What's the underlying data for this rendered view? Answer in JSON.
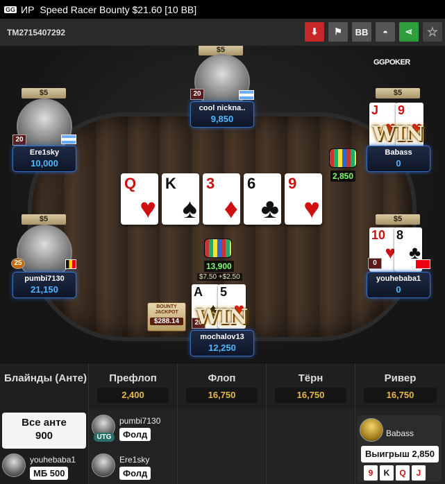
{
  "titlebar": {
    "logo": "GG",
    "game_type": "ИР",
    "title": "Speed Racer Bounty $21.60 [10 BB]"
  },
  "hud": {
    "tournament_id": "TM2715407292",
    "buttons": [
      {
        "name": "download-button",
        "label": "⬇"
      },
      {
        "name": "report-button",
        "label": "⚑"
      },
      {
        "name": "bb-toggle-button",
        "label": "BB"
      },
      {
        "name": "hide-button",
        "label": "◓"
      },
      {
        "name": "share-button",
        "label": "⋖"
      },
      {
        "name": "favorite-button",
        "label": "☆"
      }
    ]
  },
  "brand": {
    "gg": "GG",
    "poker": "POKER"
  },
  "board": [
    {
      "rank": "Q",
      "suit": "♥",
      "color": "red"
    },
    {
      "rank": "K",
      "suit": "♠",
      "color": "black"
    },
    {
      "rank": "3",
      "suit": "♦",
      "color": "red"
    },
    {
      "rank": "6",
      "suit": "♣",
      "color": "black"
    },
    {
      "rank": "9",
      "suit": "♥",
      "color": "red"
    }
  ],
  "seats": {
    "top": {
      "name": "cool nickna..",
      "stack": "9,850",
      "bet": "$5",
      "level": "20"
    },
    "left_upper": {
      "name": "Ere1sky",
      "stack": "10,000",
      "bet": "$5",
      "level": "20"
    },
    "right_upper": {
      "name": "Babass",
      "stack": "0",
      "bet": "$5",
      "win_label": "WIN",
      "cards": [
        {
          "rank": "J",
          "suit": "♥"
        },
        {
          "rank": "9",
          "suit": "♥"
        }
      ],
      "chip_count": "2,850"
    },
    "left_lower": {
      "name": "pumbi7130",
      "stack": "21,150",
      "bet": "$5",
      "level": "25"
    },
    "right_lower": {
      "name": "youhebaba1",
      "stack": "0",
      "bet": "$5",
      "level": "0",
      "cards": [
        {
          "rank": "10",
          "suit": "♥",
          "color": "red"
        },
        {
          "rank": "8",
          "suit": "♣",
          "color": "black"
        }
      ]
    },
    "hero": {
      "name": "mochalov13",
      "stack": "12,250",
      "win_label": "WIN",
      "level": "20",
      "cards": [
        {
          "rank": "A",
          "suit": "♠"
        },
        {
          "rank": "5",
          "suit": "♥"
        }
      ]
    }
  },
  "pot": {
    "total": "13,900",
    "side_bets": "$7.50 +$2.50"
  },
  "bounty_jackpot": {
    "title": "BOUNTY JACKPOT",
    "value": "$288.14"
  },
  "streets": {
    "blinds": {
      "label": "Блайнды (Анте)"
    },
    "preflop": {
      "label": "Префлоп",
      "pot": "2,400"
    },
    "flop": {
      "label": "Флоп",
      "pot": "16,750"
    },
    "turn": {
      "label": "Тёрн",
      "pot": "16,750"
    },
    "river": {
      "label": "Ривер",
      "pot": "16,750"
    }
  },
  "actions": {
    "all_ante": {
      "line1": "Все анте",
      "line2": "900"
    },
    "youhebaba1": {
      "name": "youhebaba1",
      "action": "МБ 500"
    },
    "pumbi7130": {
      "name": "pumbi7130",
      "position": "UTG",
      "action": "Фолд"
    },
    "ere1sky": {
      "name": "Ere1sky",
      "action": "Фолд"
    },
    "winner": {
      "name": "Babass",
      "result": "Выигрыш 2,850",
      "cards": [
        "9",
        "K",
        "Q",
        "J"
      ]
    }
  }
}
